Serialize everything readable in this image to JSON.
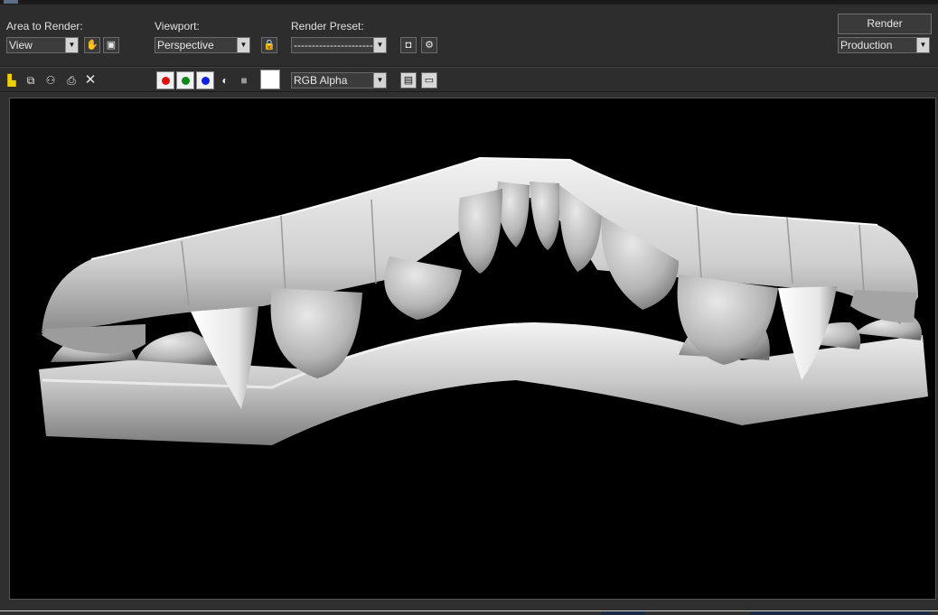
{
  "toolbar": {
    "area_label": "Area to Render:",
    "area_value": "View",
    "viewport_label": "Viewport:",
    "viewport_value": "Perspective",
    "preset_label": "Render Preset:",
    "preset_value": "----------------------------",
    "render_button": "Render",
    "production_value": "Production",
    "channel_value": "RGB Alpha"
  },
  "icons": {
    "pan": "hand-icon",
    "region": "region-icon",
    "lock": "lock-icon",
    "setup": "render-setup-icon",
    "env": "environment-effects-icon",
    "save": "save-icon",
    "copy": "copy-icon",
    "clone": "clone-window-icon",
    "print": "print-icon",
    "clear": "clear-icon",
    "mono": "monochrome-icon",
    "toggle_ui": "toggle-overlay-icon",
    "show_ui": "show-toolbar-icon"
  },
  "channels": {
    "red": "#e01010",
    "green": "#0a8a1a",
    "blue": "#1020e0"
  },
  "colors": {
    "accent": "#ffffff",
    "background": "#2f2f2f",
    "viewport_bg": "#000000"
  }
}
